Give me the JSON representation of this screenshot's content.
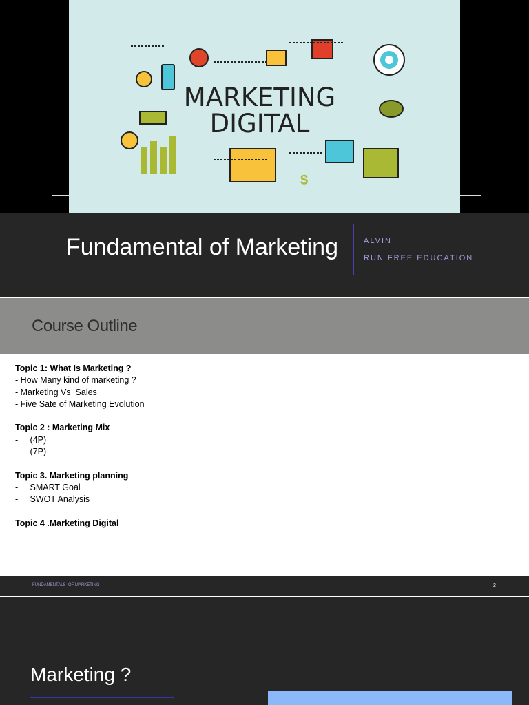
{
  "slide1": {
    "image_text": [
      "MARKETING",
      "DIGITAL"
    ],
    "title": "Fundamental of Marketing",
    "author": "ALVIN",
    "organization": "RUN FREE EDUCATION"
  },
  "slide2": {
    "title": "Course Outline",
    "topics": [
      {
        "heading": "Topic 1: What Is Marketing ?",
        "items": [
          "- How Many kind of marketing ?",
          "- Marketing Vs  Sales",
          "- Five Sate of Marketing Evolution"
        ]
      },
      {
        "heading": "Topic 2 : Marketing Mix",
        "items": [
          "-     (4P)",
          "-     (7P)"
        ]
      },
      {
        "heading": "Topic 3. Marketing planning",
        "items": [
          "-     SMART Goal",
          "-     SWOT Analysis"
        ]
      },
      {
        "heading": "Topic 4 .Marketing Digital",
        "items": []
      }
    ],
    "footer": "FUNDAMENTALS  OF MARKETING",
    "page_number": "2"
  },
  "slide3": {
    "title": "Marketing ?"
  }
}
